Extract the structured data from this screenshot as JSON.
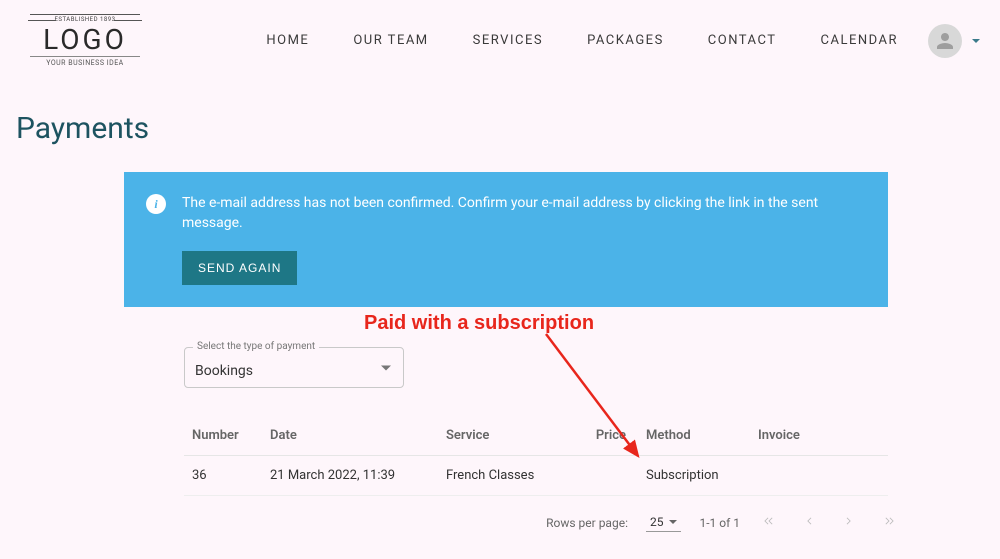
{
  "logo": {
    "top": "ESTABLISHED 1893",
    "main": "LOGO",
    "sub": "YOUR BUSINESS IDEA"
  },
  "nav": {
    "home": "HOME",
    "our_team": "OUR TEAM",
    "services": "SERVICES",
    "packages": "PACKAGES",
    "contact": "CONTACT",
    "calendar": "CALENDAR"
  },
  "page": {
    "title": "Payments"
  },
  "alert": {
    "text": "The e-mail address has not been confirmed. Confirm your e-mail address by clicking the link in the sent message.",
    "button": "SEND AGAIN"
  },
  "annotation": {
    "text": "Paid with a subscription"
  },
  "filter": {
    "label": "Select the type of payment",
    "value": "Bookings"
  },
  "table": {
    "headers": {
      "number": "Number",
      "date": "Date",
      "service": "Service",
      "price": "Price",
      "method": "Method",
      "invoice": "Invoice"
    },
    "rows": [
      {
        "number": "36",
        "date": "21 March 2022, 11:39",
        "service": "French Classes",
        "price": "",
        "method": "Subscription",
        "invoice": ""
      }
    ]
  },
  "pagination": {
    "rows_per_page_label": "Rows per page:",
    "rows_per_page_value": "25",
    "range": "1-1 of 1"
  }
}
